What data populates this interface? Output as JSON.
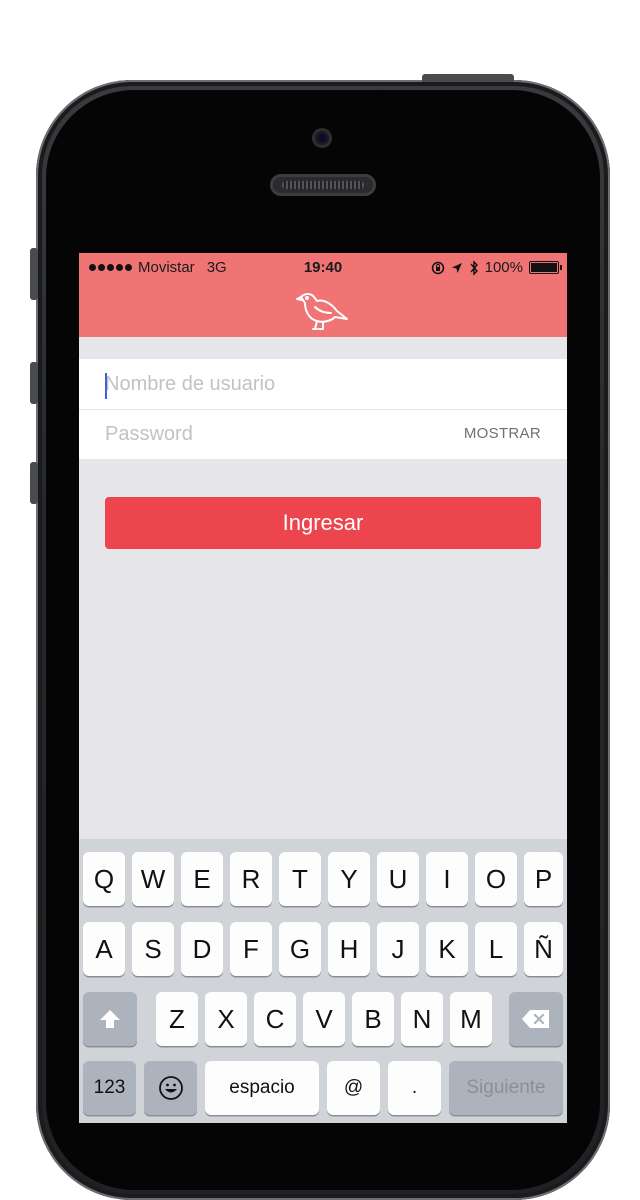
{
  "status_bar": {
    "carrier": "Movistar",
    "network": "3G",
    "time": "19:40",
    "battery": "100%"
  },
  "login": {
    "username_placeholder": "Nombre de usuario",
    "password_placeholder": "Password",
    "show_label": "MOSTRAR",
    "submit_label": "Ingresar"
  },
  "keyboard": {
    "row1": [
      "Q",
      "W",
      "E",
      "R",
      "T",
      "Y",
      "U",
      "I",
      "O",
      "P"
    ],
    "row2": [
      "A",
      "S",
      "D",
      "F",
      "G",
      "H",
      "J",
      "K",
      "L",
      "Ñ"
    ],
    "row3": [
      "Z",
      "X",
      "C",
      "V",
      "B",
      "N",
      "M"
    ],
    "numbers_label": "123",
    "space_label": "espacio",
    "at_label": "@",
    "dot_label": ".",
    "next_label": "Siguiente"
  },
  "colors": {
    "nav_bar": "#f07474",
    "button": "#ec454d",
    "background": "#e6e6ea",
    "keyboard": "#d0d4d9"
  },
  "icons": [
    "bird-logo-icon",
    "shift-icon",
    "backspace-icon",
    "emoji-icon",
    "location-arrow-icon",
    "bluetooth-icon",
    "rotation-lock-icon",
    "battery-icon"
  ]
}
